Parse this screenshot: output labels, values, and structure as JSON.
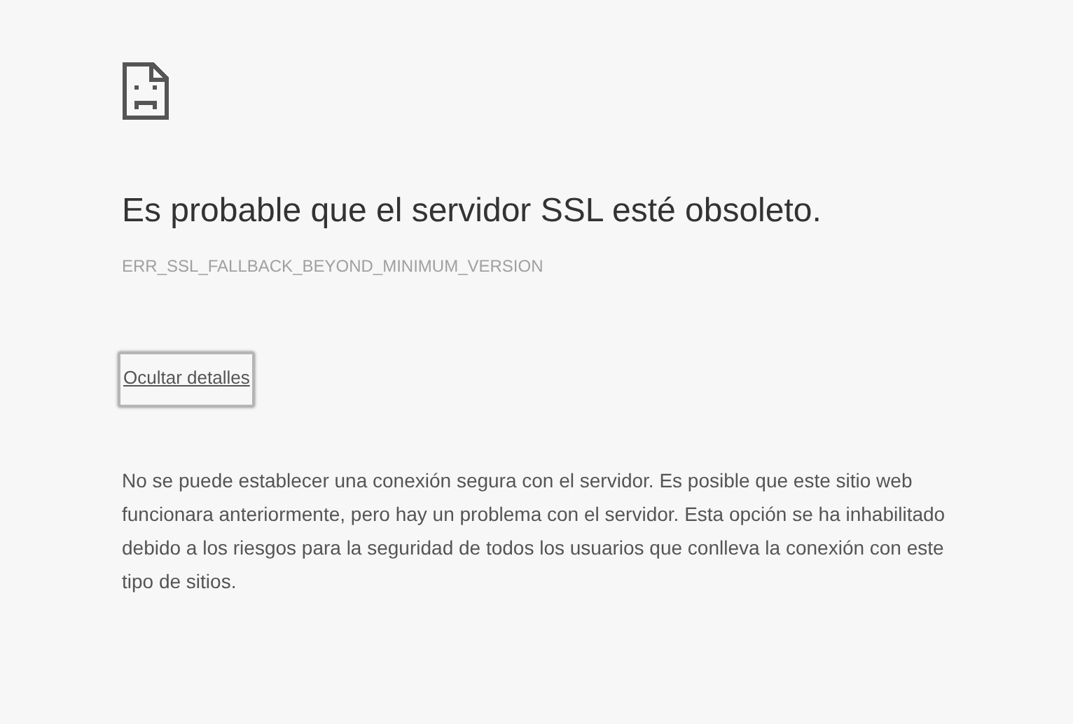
{
  "heading": "Es probable que el servidor SSL esté obsoleto.",
  "error_code": "ERR_SSL_FALLBACK_BEYOND_MINIMUM_VERSION",
  "details_link": {
    "label": "Ocultar detalles",
    "focused": true
  },
  "details_text": "No se puede establecer una conexión segura con el servidor. Es posible que este sitio web funcionara anteriormente, pero hay un problema con el servidor. Esta opción se ha inhabilitado debido a los riesgos para la seguridad de todos los usuarios que conlleva la conexión con este tipo de sitios."
}
